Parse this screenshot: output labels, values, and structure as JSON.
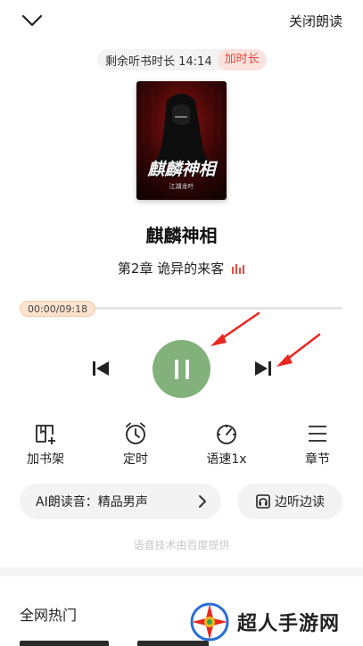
{
  "header": {
    "close_read_label": "关闭朗读"
  },
  "timer": {
    "remaining_text": "剩余听书时长 14:14",
    "add_time_label": "加时长"
  },
  "book": {
    "title": "麒麟神相",
    "chapter": "第2章 诡异的来客",
    "cover_title": "麒麟神相",
    "cover_author": "江湖龙叶"
  },
  "progress": {
    "time_text": "00:00/09:18",
    "fraction": 0.0
  },
  "controls": {
    "prev_icon": "skip-previous-icon",
    "play_icon": "pause-icon",
    "next_icon": "skip-next-icon",
    "play_color": "#82b17c"
  },
  "functions": [
    {
      "label": "加书架",
      "icon": "add-bookshelf-icon"
    },
    {
      "label": "定时",
      "icon": "alarm-clock-icon"
    },
    {
      "label": "语速1x",
      "icon": "speedometer-icon"
    },
    {
      "label": "章节",
      "icon": "menu-list-icon"
    }
  ],
  "voice": {
    "label": "AI朗读音：精品男声"
  },
  "listen_while_read": {
    "label": "边听边读"
  },
  "provider_text": "语音技术由百度提供",
  "section": {
    "title": "全网热门"
  },
  "watermark": {
    "text": "超人手游网"
  },
  "colors": {
    "accent_red": "#e84a3c",
    "arrow_red": "#e8271f",
    "progress_chip": "#fde3cf"
  }
}
